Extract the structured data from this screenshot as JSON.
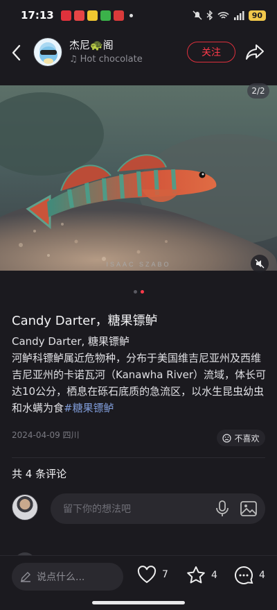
{
  "status_bar": {
    "time": "17:13",
    "battery": "90",
    "app_icon_colors": [
      "#e0323c",
      "#e64545",
      "#f0c630",
      "#3bb24a",
      "#d93a3a"
    ]
  },
  "header": {
    "author_name": "杰尼🐢阁",
    "music": "Hot chocolate",
    "follow_label": "关注"
  },
  "photo": {
    "counter": "2/2",
    "watermark": "ISAAC SZABO"
  },
  "post": {
    "title": "Candy Darter，糖果镖鲈",
    "body": "Candy Darter, 糖果镖鲈\n河鲈科镖鲈属近危物种，分布于美国维吉尼亚州及西维吉尼亚州的卡诺瓦河（Kanawha River）流域，体长可达10公分，栖息在砾石底质的急流区，以水生昆虫幼虫和水螨为食",
    "hashtag": "#糖果镖鲈",
    "meta": "2024-04-09 四川",
    "dislike_label": "不喜欢"
  },
  "comments": {
    "count_label": "共 4 条评论",
    "input_placeholder": "留下你的想法吧"
  },
  "bottom_bar": {
    "say_placeholder": "说点什么...",
    "likes": "7",
    "favorites": "4",
    "comments": "4"
  },
  "colors": {
    "accent": "#ff3a4a",
    "hashtag": "#7e9ad6",
    "background": "#1b1a1f"
  }
}
